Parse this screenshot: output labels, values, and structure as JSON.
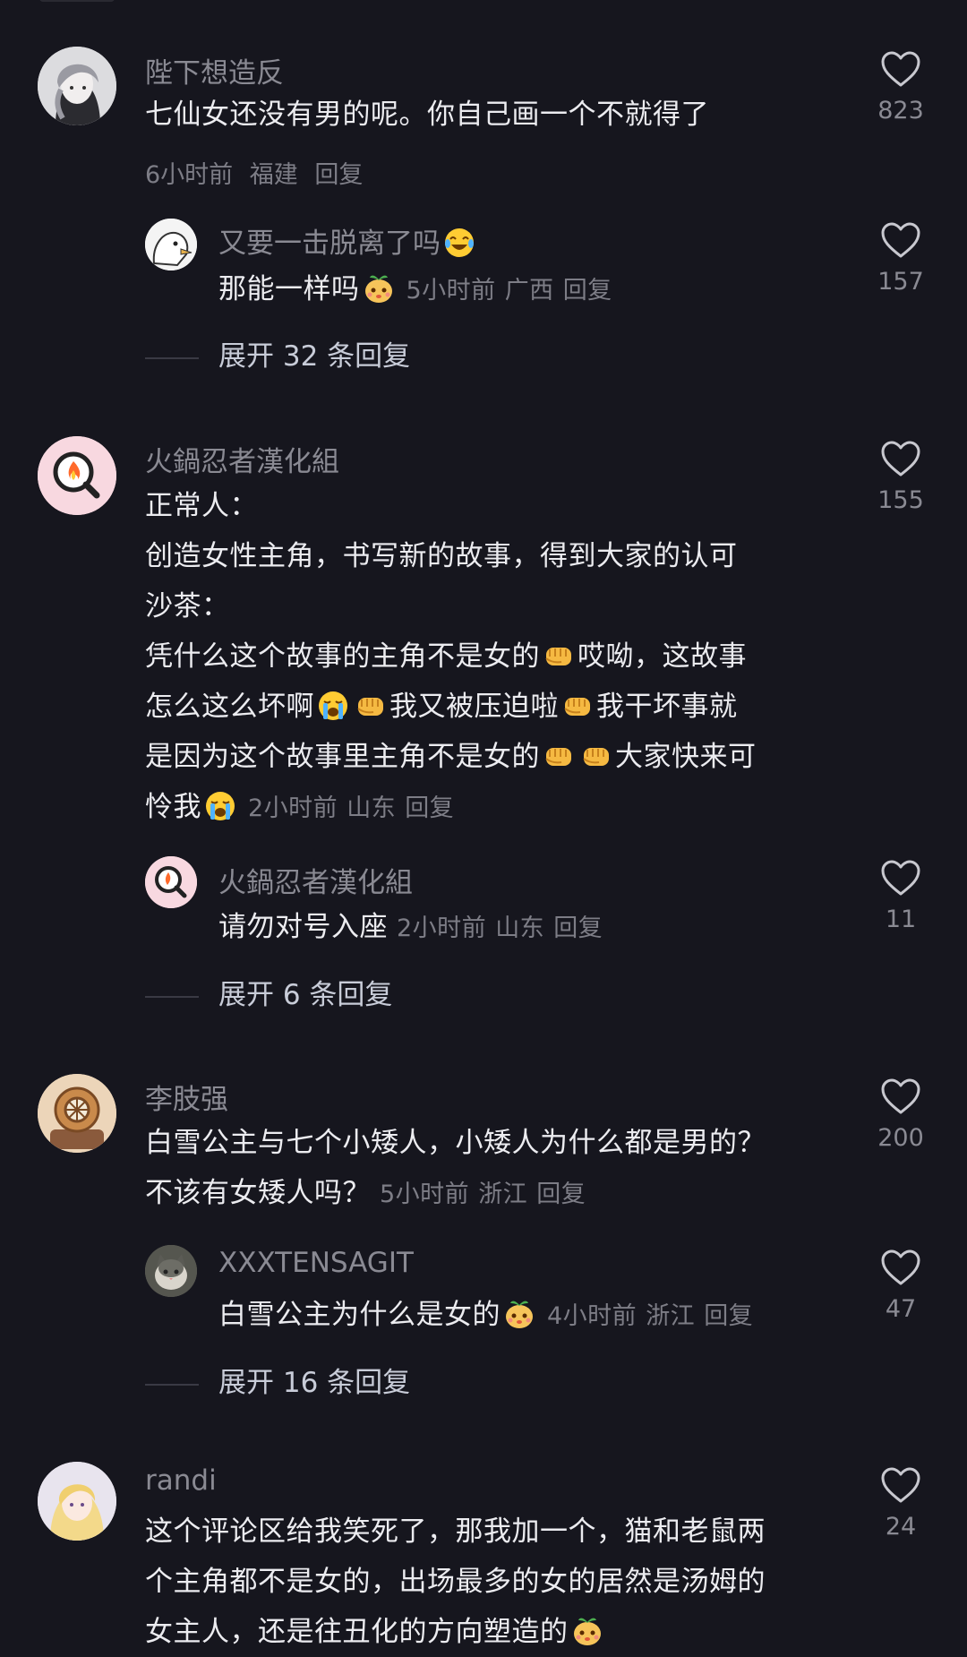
{
  "comments": [
    {
      "username": "陛下想造反",
      "lines": [
        "七仙女还没有男的呢。你自己画一个不就得了"
      ],
      "meta": {
        "time": "6小时前",
        "location": "福建",
        "reply": "回复"
      },
      "likes": "823",
      "reply": {
        "username": "又要一击脱离了吗",
        "text": "那能一样吗",
        "meta": {
          "time": "5小时前",
          "location": "广西",
          "reply": "回复"
        },
        "likes": "157"
      },
      "expand": "展开 32 条回复"
    },
    {
      "username": "火鍋忍者漢化組",
      "lines": [
        "正常人：",
        "创造女性主角，书写新的故事，得到大家的认可",
        "沙茶：",
        "凭什么这个故事的主角不是女的",
        "怎么这么坏啊",
        "是因为这个故事里主角不是女的",
        "怜我"
      ],
      "line4_tail": "哎呦，这故事",
      "line5_mid1": "我又被压迫啦",
      "line5_mid2": "我干坏事就",
      "line6_tail": "大家快来可",
      "meta": {
        "time": "2小时前",
        "location": "山东",
        "reply": "回复"
      },
      "likes": "155",
      "reply": {
        "username": "火鍋忍者漢化組",
        "text": "请勿对号入座",
        "meta": {
          "time": "2小时前",
          "location": "山东",
          "reply": "回复"
        },
        "likes": "11"
      },
      "expand": "展开 6 条回复"
    },
    {
      "username": "李肢强",
      "lines": [
        "白雪公主与七个小矮人，小矮人为什么都是男的？",
        "不该有女矮人吗？"
      ],
      "meta": {
        "time": "5小时前",
        "location": "浙江",
        "reply": "回复"
      },
      "likes": "200",
      "reply": {
        "username": "XXXTENSAGIT",
        "text": "白雪公主为什么是女的",
        "meta": {
          "time": "4小时前",
          "location": "浙江",
          "reply": "回复"
        },
        "likes": "47"
      },
      "expand": "展开 16 条回复"
    },
    {
      "username": "randi",
      "lines": [
        "这个评论区给我笑死了，那我加一个，猫和老鼠两",
        "个主角都不是女的，出场最多的女的居然是汤姆的",
        "女主人，还是往丑化的方向塑造的"
      ],
      "likes": "24"
    }
  ],
  "icons": {
    "like": "heart-outline-icon",
    "emoji_laugh": "tears-of-joy-emoji",
    "emoji_sprout": "sprout-face-emoji",
    "emoji_fist": "fist-emoji",
    "emoji_cry": "loudly-crying-emoji"
  },
  "colors": {
    "background": "#16161e",
    "username": "#8a8a93",
    "text": "#ececf0",
    "meta": "#7d7d86",
    "expand": "#c8ccd8"
  }
}
